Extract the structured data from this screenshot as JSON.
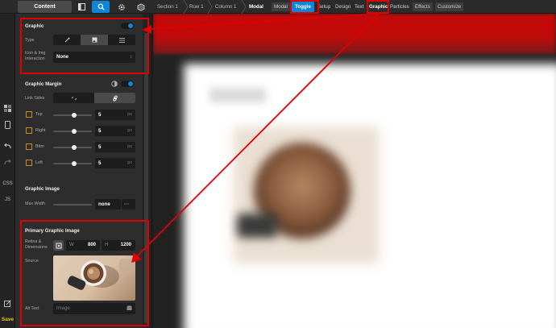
{
  "colors": {
    "accent": "#0b86d8",
    "annotation": "#e00000",
    "save": "#f2c200"
  },
  "topbar": {
    "content_tab": "Content",
    "breadcrumbs": [
      "Section 1",
      "Row 1",
      "Column 1",
      "Modal"
    ],
    "tabs": [
      "Modal",
      "Toggle",
      "Setup",
      "Design",
      "Text",
      "Graphic",
      "Particles",
      "Effects",
      "Customize"
    ]
  },
  "rail": {
    "css": "CSS",
    "js": "JS",
    "save": "Save"
  },
  "graphic": {
    "title": "Graphic",
    "type_label": "Type",
    "icon_img_label": "Icon & Img Interaction",
    "icon_img_value": "None"
  },
  "margin": {
    "title": "Graphic Margin",
    "link_sides_label": "Link Sides",
    "rows": [
      {
        "label": "Top",
        "value": "5",
        "unit": "px",
        "level": 0.55
      },
      {
        "label": "Right",
        "value": "5",
        "unit": "px",
        "level": 0.55
      },
      {
        "label": "Bttm",
        "value": "5",
        "unit": "px",
        "level": 0.55
      },
      {
        "label": "Left",
        "value": "5",
        "unit": "px",
        "level": 0.55
      }
    ]
  },
  "image": {
    "title": "Graphic Image",
    "max_width_label": "Max Width",
    "max_width_value": "none",
    "more": "···"
  },
  "primary": {
    "title": "Primary Graphic Image",
    "retina_label": "Retina & Dimensions",
    "w_key": "W",
    "w_value": "800",
    "h_key": "H",
    "h_value": "1200",
    "source_label": "Source",
    "alt_label": "Alt Text",
    "alt_placeholder": "Image"
  }
}
